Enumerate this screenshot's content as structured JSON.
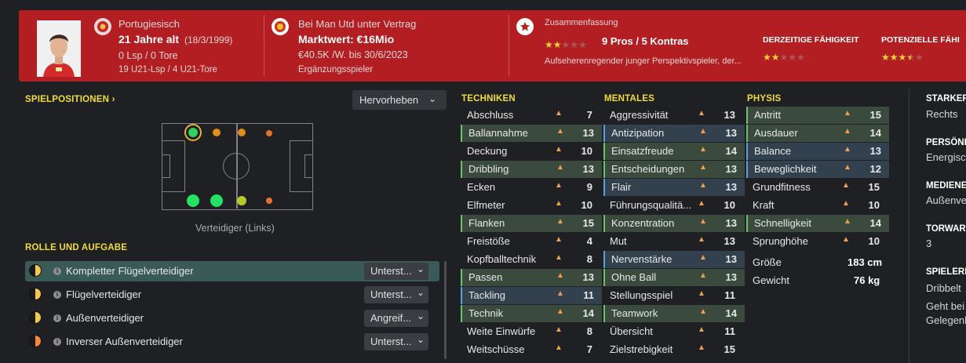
{
  "header": {
    "nationality": "Portugiesisch",
    "age": "21 Jahre alt",
    "birthdate": "(18/3/1999)",
    "caps_goals": "0 Lsp / 0 Tore",
    "u21": "19 U21-Lsp / 4 U21-Tore",
    "contract": "Bei Man Utd unter Vertrag",
    "value": "Marktwert: €16Mio",
    "wage": "€40.5K /W. bis 30/6/2023",
    "squad_status": "Ergänzungsspieler",
    "summary_label": "Zusammenfassung",
    "pros_cons": "9 Pros / 5 Kontras",
    "summary_text": "Aufseherenregender junger Perspektivspieler, der...",
    "summary_stars": 2,
    "current_ability_label": "DERZEITIGE FÄHIGKEIT",
    "current_ability_stars": 2,
    "potential_ability_label": "POTENZIELLE FÄHI",
    "potential_ability_stars": 3.5
  },
  "positions": {
    "title": "SPIELPOSITIONEN",
    "chevron": "›",
    "highlight_select": "Hervorheben",
    "position_caption": "Verteidiger (Links)"
  },
  "roles": {
    "title": "ROLLE UND AUFGABE",
    "items": [
      {
        "name": "Kompletter Flügelverteidiger",
        "duty": "Unterst...",
        "selected": true
      },
      {
        "name": "Flügelverteidiger",
        "duty": "Unterst...",
        "selected": false
      },
      {
        "name": "Außenverteidiger",
        "duty": "Angreif...",
        "selected": false
      },
      {
        "name": "Inverser Außenverteidiger",
        "duty": "Unterst...",
        "selected": false
      }
    ]
  },
  "attributes": {
    "technical_title": "TECHNIKEN",
    "mental_title": "MENTALES",
    "physical_title": "PHYSIS",
    "technical": [
      {
        "name": "Abschluss",
        "value": "7",
        "hl": ""
      },
      {
        "name": "Ballannahme",
        "value": "13",
        "hl": "green"
      },
      {
        "name": "Deckung",
        "value": "10",
        "hl": ""
      },
      {
        "name": "Dribbling",
        "value": "13",
        "hl": "green"
      },
      {
        "name": "Ecken",
        "value": "9",
        "hl": ""
      },
      {
        "name": "Elfmeter",
        "value": "10",
        "hl": ""
      },
      {
        "name": "Flanken",
        "value": "15",
        "hl": "green"
      },
      {
        "name": "Freistöße",
        "value": "4",
        "hl": ""
      },
      {
        "name": "Kopfballtechnik",
        "value": "8",
        "hl": ""
      },
      {
        "name": "Passen",
        "value": "13",
        "hl": "green"
      },
      {
        "name": "Tackling",
        "value": "11",
        "hl": "blue"
      },
      {
        "name": "Technik",
        "value": "14",
        "hl": "green"
      },
      {
        "name": "Weite Einwürfe",
        "value": "8",
        "hl": ""
      },
      {
        "name": "Weitschüsse",
        "value": "7",
        "hl": ""
      }
    ],
    "mental": [
      {
        "name": "Aggressivität",
        "value": "13",
        "hl": ""
      },
      {
        "name": "Antizipation",
        "value": "13",
        "hl": "blue"
      },
      {
        "name": "Einsatzfreude",
        "value": "14",
        "hl": "green"
      },
      {
        "name": "Entscheidungen",
        "value": "13",
        "hl": "green"
      },
      {
        "name": "Flair",
        "value": "13",
        "hl": "blue"
      },
      {
        "name": "Führungsqualitä...",
        "value": "10",
        "hl": ""
      },
      {
        "name": "Konzentration",
        "value": "13",
        "hl": "green"
      },
      {
        "name": "Mut",
        "value": "13",
        "hl": ""
      },
      {
        "name": "Nervenstärke",
        "value": "13",
        "hl": "blue"
      },
      {
        "name": "Ohne Ball",
        "value": "13",
        "hl": "green"
      },
      {
        "name": "Stellungsspiel",
        "value": "11",
        "hl": ""
      },
      {
        "name": "Teamwork",
        "value": "14",
        "hl": "green"
      },
      {
        "name": "Übersicht",
        "value": "11",
        "hl": ""
      },
      {
        "name": "Zielstrebigkeit",
        "value": "15",
        "hl": ""
      }
    ],
    "physical": [
      {
        "name": "Antritt",
        "value": "15",
        "hl": "green"
      },
      {
        "name": "Ausdauer",
        "value": "14",
        "hl": "green"
      },
      {
        "name": "Balance",
        "value": "13",
        "hl": "blue"
      },
      {
        "name": "Beweglichkeit",
        "value": "12",
        "hl": "blue"
      },
      {
        "name": "Grundfitness",
        "value": "15",
        "hl": ""
      },
      {
        "name": "Kraft",
        "value": "10",
        "hl": ""
      },
      {
        "name": "Schnelligkeit",
        "value": "14",
        "hl": "green"
      },
      {
        "name": "Sprunghöhe",
        "value": "10",
        "hl": ""
      }
    ],
    "height_label": "Größe",
    "height_value": "183 cm",
    "weight_label": "Gewicht",
    "weight_value": "76 kg"
  },
  "right_panel": {
    "foot_label": "STARKER",
    "foot_value": "Rechts",
    "personality_label": "PERSÖNI",
    "personality_value": "Energisc",
    "media_label": "MEDIENE",
    "media_value": "Außenver",
    "torwart_label": "TORWAR",
    "torwart_value": "3",
    "traits_label": "SPIELERE",
    "traits_1": "Dribbelt",
    "traits_2": "Geht bei",
    "traits_3": "Gelegenh"
  },
  "colors": {
    "header_bg": "#b21e22",
    "page_bg": "#1e2023",
    "accent_yellow": "#f2dd3a",
    "green_highlight": "#6ec06a",
    "blue_highlight": "#5aa0e0"
  }
}
